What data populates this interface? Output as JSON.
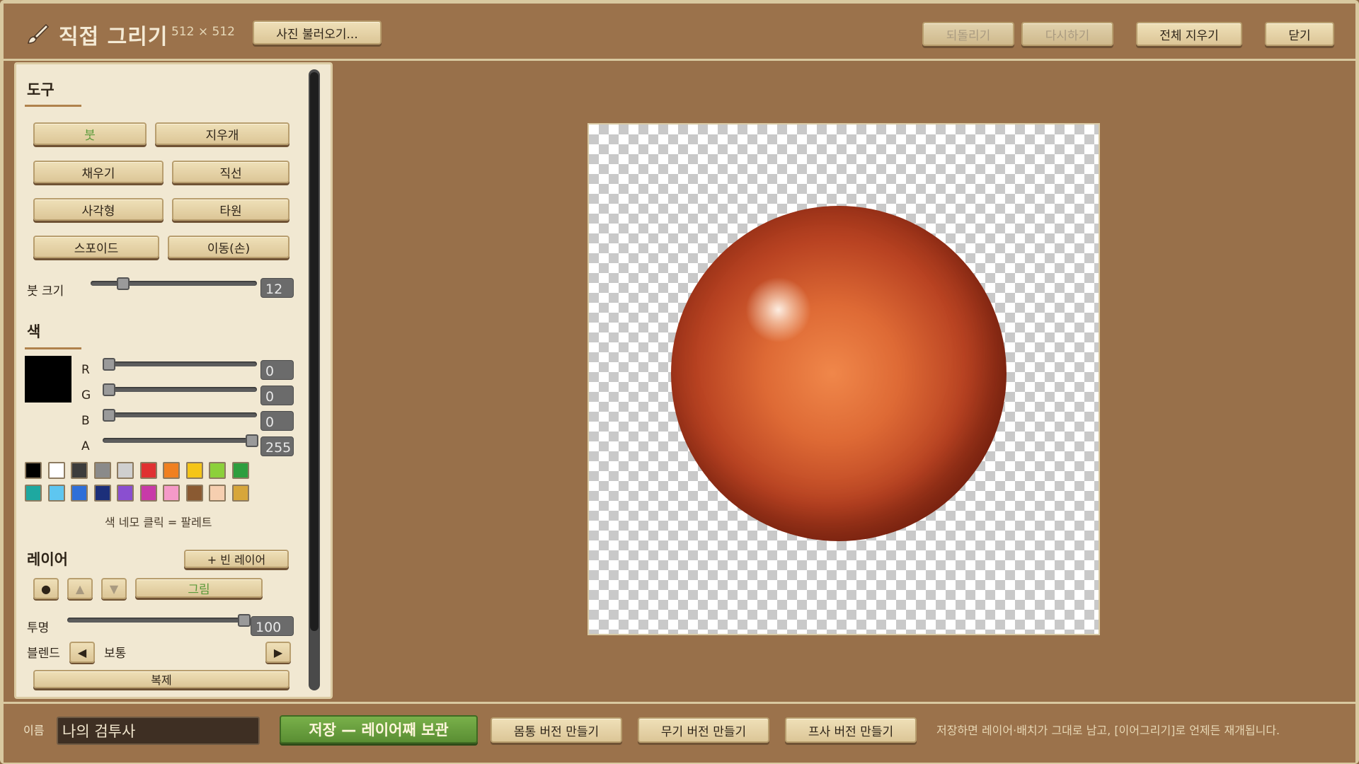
{
  "header": {
    "title": "직접 그리기",
    "canvas_size": "512 × 512",
    "load_photo": "사진 불러오기...",
    "undo": "되돌리기",
    "redo": "다시하기",
    "clear_all": "전체 지우기",
    "close": "닫기"
  },
  "tools": {
    "title": "도구",
    "brush": "붓",
    "eraser": "지우개",
    "fill": "채우기",
    "line": "직선",
    "rect": "사각형",
    "ellipse": "타원",
    "eyedropper": "스포이드",
    "move": "이동(손)",
    "brush_size_label": "붓 크기",
    "brush_size": "12",
    "brush_size_fraction": 0.19
  },
  "color": {
    "title": "색",
    "current": "#000000",
    "r_label": "R",
    "r": "0",
    "g_label": "G",
    "g": "0",
    "b_label": "B",
    "b": "0",
    "a_label": "A",
    "a": "255",
    "palette_hint": "색 네모 클릭 = 팔레트",
    "palette": [
      "#000000",
      "#ffffff",
      "#3c3c3c",
      "#8a8a8a",
      "#cfcfcf",
      "#e03131",
      "#f08020",
      "#f5c518",
      "#8cd03a",
      "#2e9e3e",
      "#1ea8a0",
      "#5ec6f0",
      "#2f6fd8",
      "#1c2f7a",
      "#8a4fd0",
      "#c83aa8",
      "#f59ac8",
      "#8a5a32",
      "#f6cfb0",
      "#d7a63a"
    ]
  },
  "layers": {
    "title": "레이어",
    "add_empty": "+ 빈 레이어",
    "layer_name": "그림",
    "opacity_label": "투명",
    "opacity": "100",
    "blend_label": "블렌드",
    "blend_mode": "보통",
    "duplicate": "복제"
  },
  "footer": {
    "name_label": "이름",
    "name_value": "나의 검투사",
    "save": "저장 — 레이어째 보관",
    "body_version": "몸통 버전 만들기",
    "weapon_version": "무기 버전 만들기",
    "projectile_version": "프사 버전 만들기",
    "hint": "저장하면 레이어·배치가 그대로 남고, [이어그리기]로 언제든 재개됩니다."
  }
}
